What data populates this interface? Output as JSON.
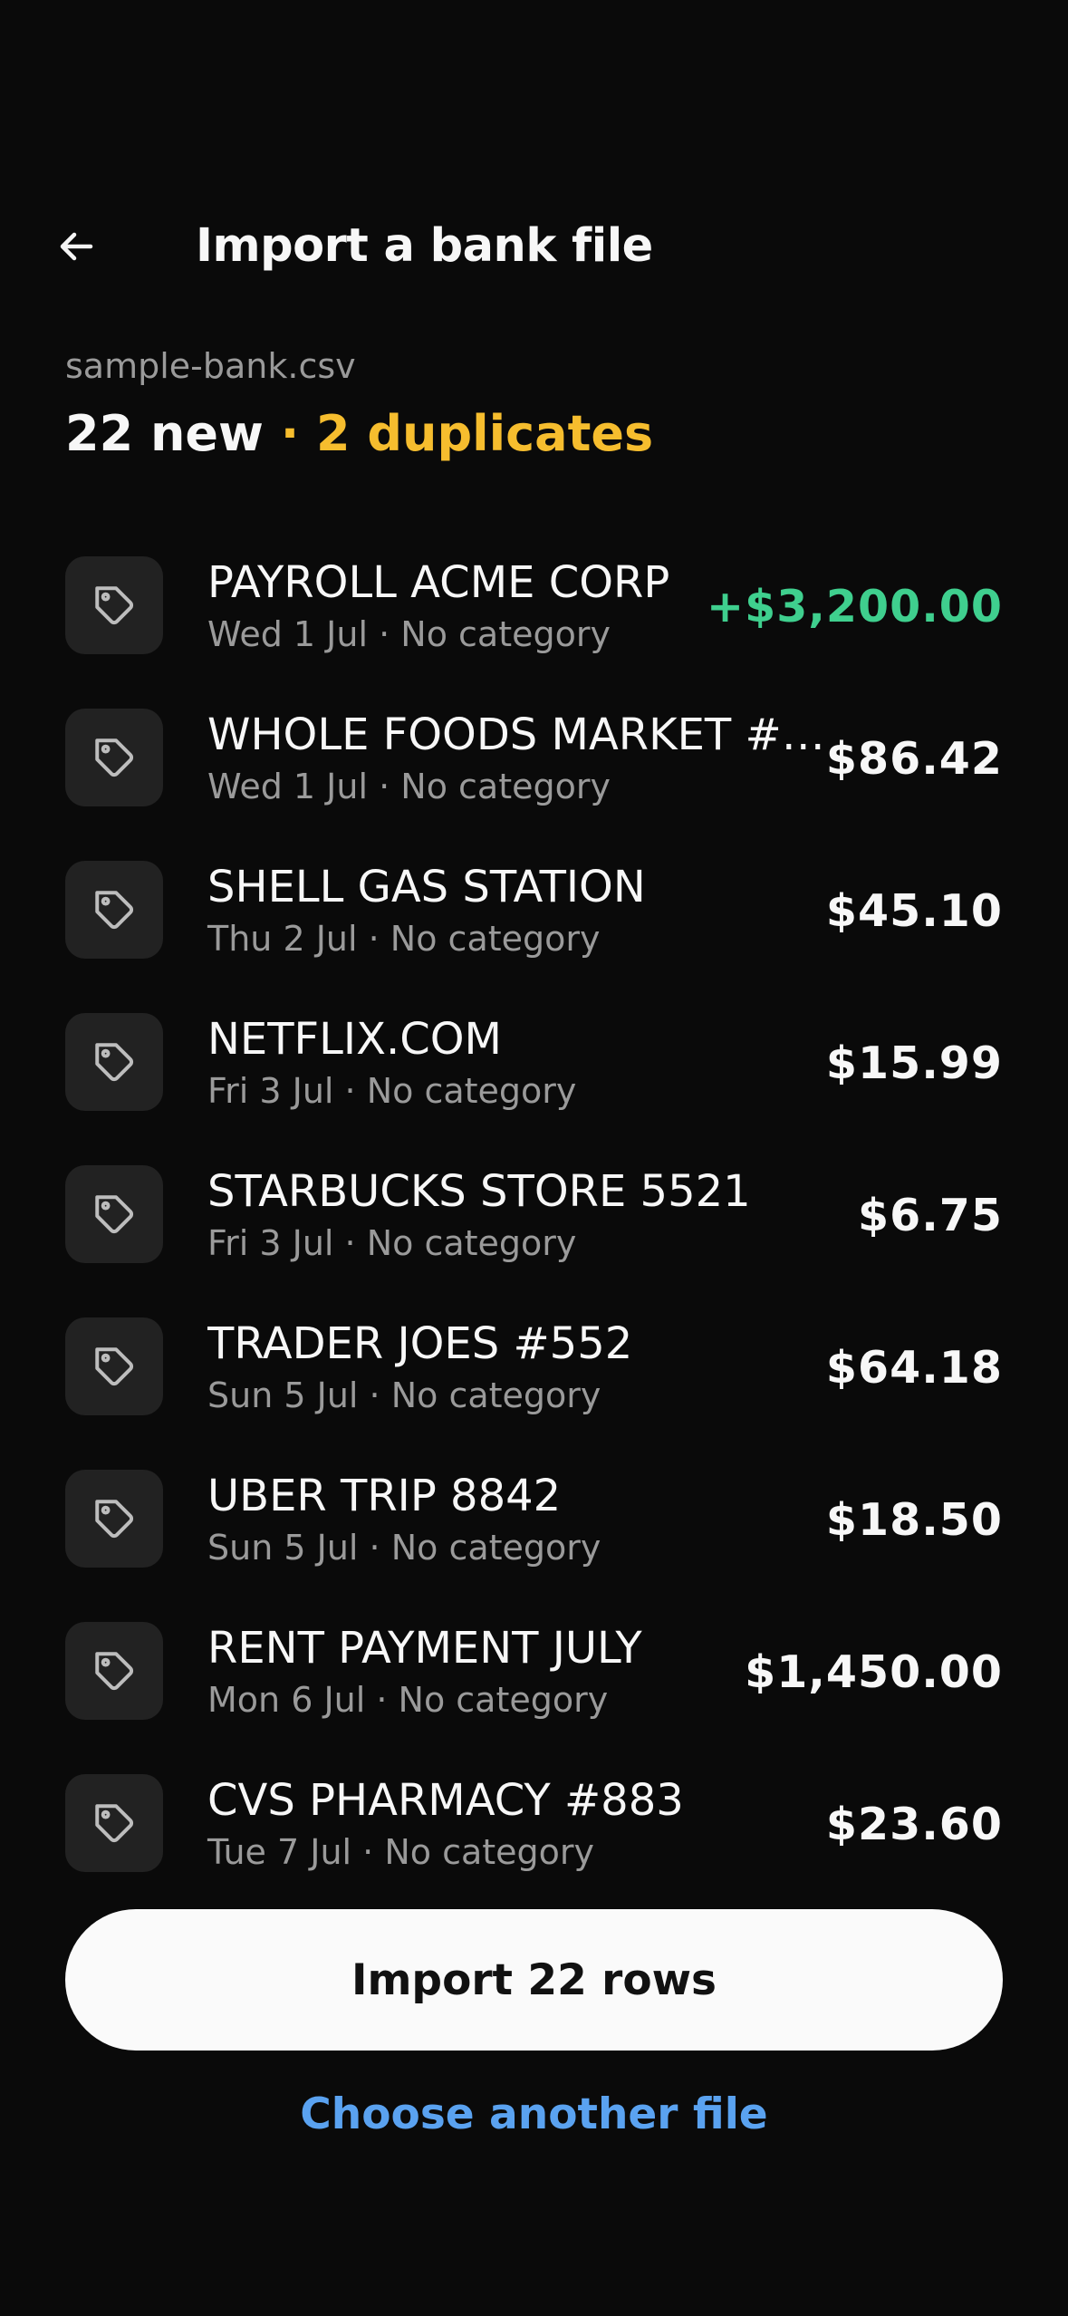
{
  "header": {
    "back_icon": "arrow-left-icon",
    "title": "Import a bank file"
  },
  "file": {
    "name": "sample-bank.csv",
    "new_count_label": "22 new",
    "duplicates_label": " · 2 duplicates"
  },
  "colors": {
    "background": "#0a0a0a",
    "duplicates_accent": "#f6bd2e",
    "income_green": "#3fcf8e",
    "link_blue": "#5aa2f0",
    "icon_tile": "#222222"
  },
  "transactions": [
    {
      "icon": "tag-icon",
      "title": "PAYROLL ACME CORP",
      "subtitle": "Wed 1 Jul · No category",
      "amount": "+$3,200.00",
      "income": true
    },
    {
      "icon": "tag-icon",
      "title": "WHOLE FOODS MARKET #…",
      "subtitle": "Wed 1 Jul · No category",
      "amount": "$86.42",
      "income": false
    },
    {
      "icon": "tag-icon",
      "title": "SHELL GAS STATION",
      "subtitle": "Thu 2 Jul · No category",
      "amount": "$45.10",
      "income": false
    },
    {
      "icon": "tag-icon",
      "title": "NETFLIX.COM",
      "subtitle": "Fri 3 Jul · No category",
      "amount": "$15.99",
      "income": false
    },
    {
      "icon": "tag-icon",
      "title": "STARBUCKS STORE 5521",
      "subtitle": "Fri 3 Jul · No category",
      "amount": "$6.75",
      "income": false
    },
    {
      "icon": "tag-icon",
      "title": "TRADER JOES #552",
      "subtitle": "Sun 5 Jul · No category",
      "amount": "$64.18",
      "income": false
    },
    {
      "icon": "tag-icon",
      "title": "UBER TRIP 8842",
      "subtitle": "Sun 5 Jul · No category",
      "amount": "$18.50",
      "income": false
    },
    {
      "icon": "tag-icon",
      "title": "RENT PAYMENT JULY",
      "subtitle": "Mon 6 Jul · No category",
      "amount": "$1,450.00",
      "income": false
    },
    {
      "icon": "tag-icon",
      "title": "CVS PHARMACY #883",
      "subtitle": "Tue 7 Jul · No category",
      "amount": "$23.60",
      "income": false
    }
  ],
  "actions": {
    "import_label": "Import 22 rows",
    "choose_another_label": "Choose another file"
  }
}
